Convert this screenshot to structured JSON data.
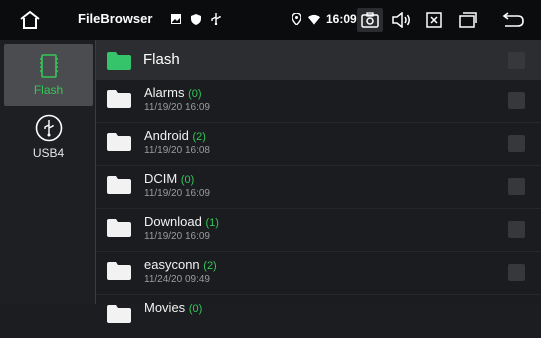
{
  "statusbar": {
    "app_title": "FileBrowser",
    "time": "16:09",
    "left_icons": [
      "image-icon",
      "shield-icon",
      "usb-icon"
    ],
    "right_icons": [
      "location-icon",
      "wifi-icon"
    ],
    "nav_icons": [
      "screenshot-icon",
      "volume-icon",
      "close-window-icon",
      "window-icon",
      "back-icon"
    ]
  },
  "sidebar": {
    "items": [
      {
        "label": "Flash",
        "icon": "sd-card-icon",
        "active": true
      },
      {
        "label": "USB4",
        "icon": "usb-icon",
        "active": false
      }
    ]
  },
  "main": {
    "title": "Flash",
    "rows": [
      {
        "name": "Alarms",
        "count": "(0)",
        "date": "11/19/20 16:09"
      },
      {
        "name": "Android",
        "count": "(2)",
        "date": "11/19/20 16:08"
      },
      {
        "name": "DCIM",
        "count": "(0)",
        "date": "11/19/20 16:09"
      },
      {
        "name": "Download",
        "count": "(1)",
        "date": "11/19/20 16:09"
      },
      {
        "name": "easyconn",
        "count": "(2)",
        "date": "11/24/20 09:49"
      },
      {
        "name": "Movies",
        "count": "(0)",
        "date": ""
      }
    ]
  },
  "colors": {
    "accent": "#34c758",
    "folder_header": "#36c46a",
    "folder_row": "#f2f2f2"
  }
}
